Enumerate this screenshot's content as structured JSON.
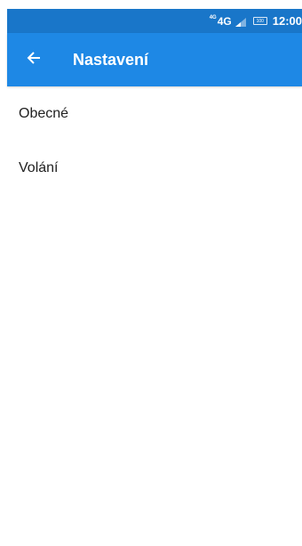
{
  "status_bar": {
    "network_prefix": "4G",
    "network": "4G",
    "battery_level": "100",
    "time": "12:00",
    "icons": [
      "signal-icon",
      "battery-icon"
    ],
    "background_color": "#1976c9"
  },
  "app_bar": {
    "title": "Nastavení",
    "back_icon": "arrow-back-icon",
    "background_color": "#1e88e5"
  },
  "menu": {
    "items": [
      {
        "label": "Obecné"
      },
      {
        "label": "Volání"
      }
    ]
  }
}
